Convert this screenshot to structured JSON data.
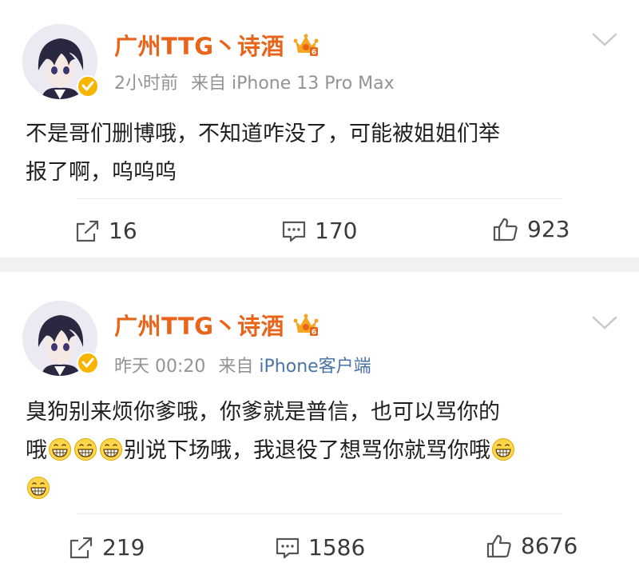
{
  "posts": [
    {
      "author": "广州TTG丶诗酒",
      "time": "2小时前",
      "source_prefix": "来自",
      "source": "iPhone 13 Pro Max",
      "text_line1": "不是哥们删博哦，不知道咋没了，可能被姐姐们举",
      "text_line2": "报了啊，呜呜呜",
      "repost_count": "16",
      "comment_count": "170",
      "like_count": "923"
    },
    {
      "author": "广州TTG丶诗酒",
      "time": "昨天 00:20",
      "source_prefix": "来自",
      "source": "iPhone客户端",
      "text_line1": "臭狗别来烦你爹哦，你爹就是普信，也可以骂你的",
      "text_line2_a": "哦",
      "text_line2_b": "别说下场哦，我退役了想骂你就骂你哦",
      "repost_count": "219",
      "comment_count": "1586",
      "like_count": "8676"
    }
  ],
  "icons": {
    "verified": "verified-badge-icon",
    "crown": "vip-crown-icon",
    "more": "chevron-down-icon",
    "repost": "repost-icon",
    "comment": "comment-icon",
    "like": "thumbs-up-icon",
    "emoji": "grin-emoji-icon"
  },
  "colors": {
    "author": "#e8641b",
    "meta": "#939393",
    "source_link": "#4a73a8",
    "separator": "#f2f2f2"
  }
}
